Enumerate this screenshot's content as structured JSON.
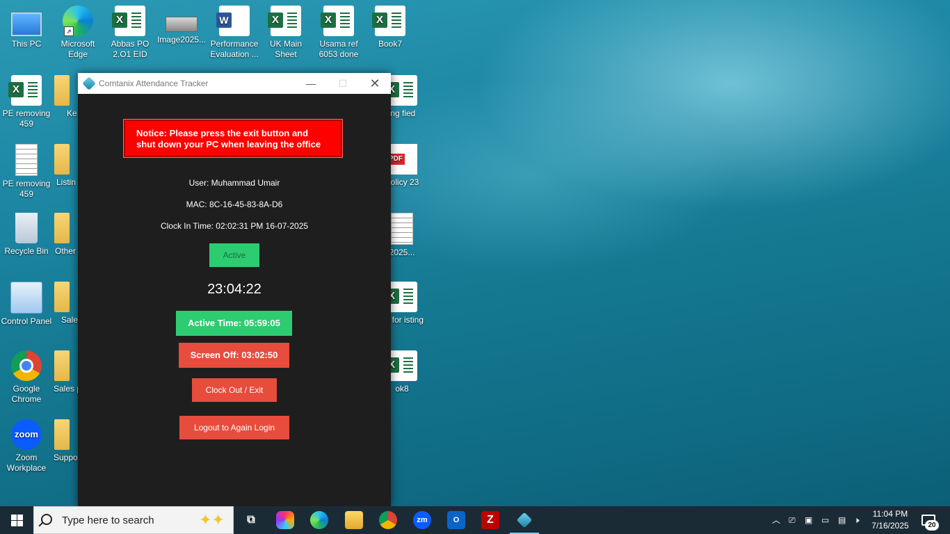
{
  "desktop": {
    "icons": [
      {
        "label": "This PC"
      },
      {
        "label": "Microsoft Edge"
      },
      {
        "label": "Abbas PO 2.O1  EID"
      },
      {
        "label": "Image2025..."
      },
      {
        "label": "Performance Evaluation ..."
      },
      {
        "label": "UK Main Sheet"
      },
      {
        "label": "Usama ref 6053 done"
      },
      {
        "label": "Book7"
      },
      {
        "label": "PE removing 459"
      },
      {
        "label": "PE removing 459"
      },
      {
        "label": "Recycle Bin"
      },
      {
        "label": "Control Panel"
      },
      {
        "label": "Google Chrome"
      },
      {
        "label": "Zoom Workplace"
      },
      {
        "label": "Ke"
      },
      {
        "label": "Listin"
      },
      {
        "label": "Other"
      },
      {
        "label": "Sale"
      },
      {
        "label": "Sales p fil"
      },
      {
        "label": "Suppo"
      },
      {
        "label": "ing fied"
      },
      {
        "label": "Policy 23"
      },
      {
        "label": "2025..."
      },
      {
        "label": "ee for isting"
      },
      {
        "label": "ok8"
      }
    ]
  },
  "window": {
    "title": "Comtanix Attendance Tracker",
    "notice": "Notice: Please press the exit button and shut down your PC when leaving the office",
    "user": "User: Muhammad Umair",
    "mac": "MAC: 8C-16-45-83-8A-D6",
    "clock_in": "Clock In Time: 02:02:31 PM 16-07-2025",
    "status": "Active",
    "current_time": "23:04:22",
    "active_time": "Active Time: 05:59:05",
    "screen_off": "Screen Off: 03:02:50",
    "clock_out_label": "Clock Out / Exit",
    "logout_label": "Logout to Again Login"
  },
  "taskbar": {
    "search_placeholder": "Type here to search",
    "apps": [
      "task-view",
      "copilot",
      "edge",
      "file-explorer",
      "chrome",
      "zoom",
      "outlook",
      "filezilla",
      "attendance-tracker"
    ],
    "time": "11:04 PM",
    "date": "7/16/2025",
    "notification_count": "20"
  }
}
